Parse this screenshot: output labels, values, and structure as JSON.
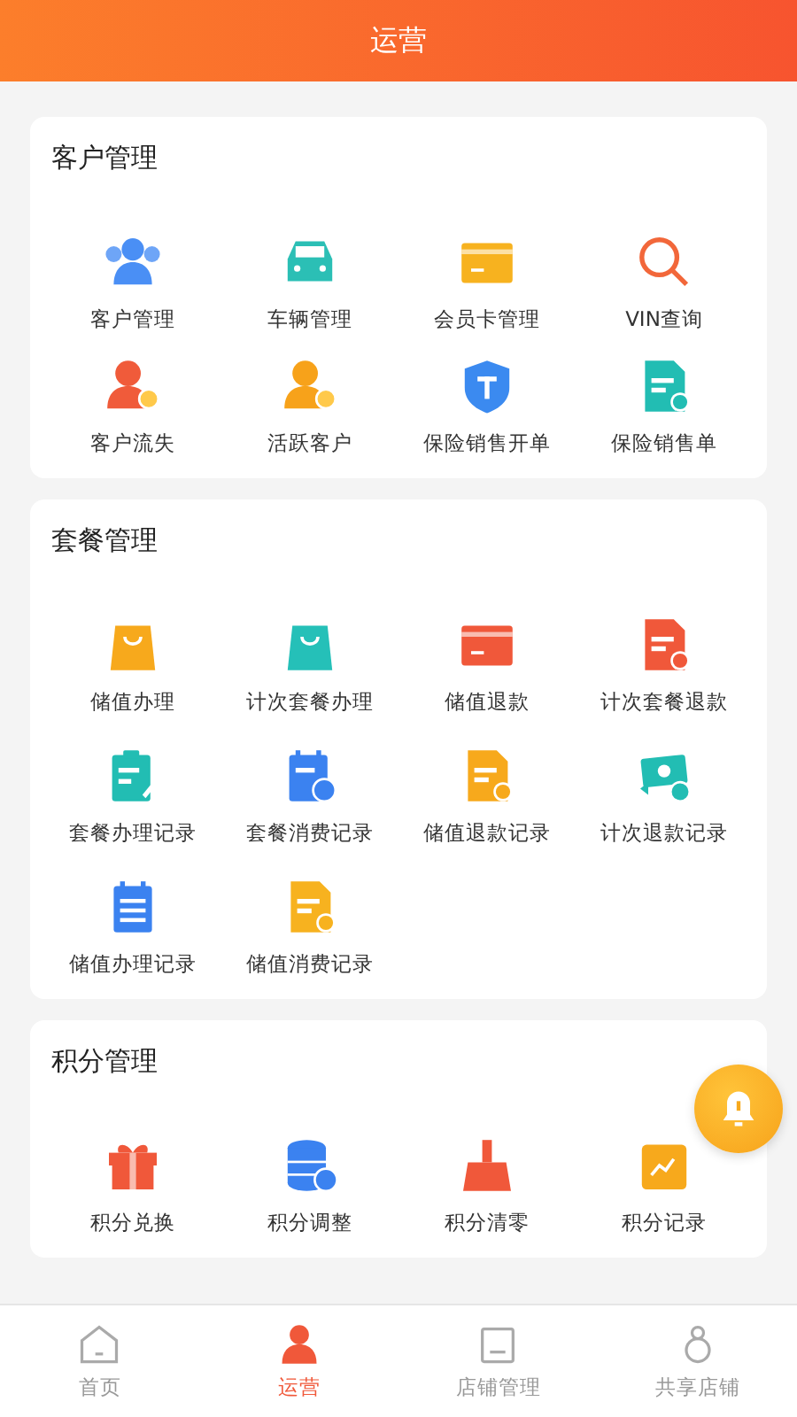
{
  "header": {
    "title": "运营"
  },
  "sections": [
    {
      "title": "客户管理",
      "items": [
        {
          "label": "客户管理"
        },
        {
          "label": "车辆管理"
        },
        {
          "label": "会员卡管理"
        },
        {
          "label": "VIN查询"
        },
        {
          "label": "客户流失"
        },
        {
          "label": "活跃客户"
        },
        {
          "label": "保险销售开单"
        },
        {
          "label": "保险销售单"
        }
      ]
    },
    {
      "title": "套餐管理",
      "items": [
        {
          "label": "储值办理"
        },
        {
          "label": "计次套餐办理"
        },
        {
          "label": "储值退款"
        },
        {
          "label": "计次套餐退款"
        },
        {
          "label": "套餐办理记录"
        },
        {
          "label": "套餐消费记录"
        },
        {
          "label": "储值退款记录"
        },
        {
          "label": "计次退款记录"
        },
        {
          "label": "储值办理记录"
        },
        {
          "label": "储值消费记录"
        }
      ]
    },
    {
      "title": "积分管理",
      "items": [
        {
          "label": "积分兑换"
        },
        {
          "label": "积分调整"
        },
        {
          "label": "积分清零"
        },
        {
          "label": "积分记录"
        }
      ]
    }
  ],
  "tabs": [
    {
      "label": "首页",
      "selected": false
    },
    {
      "label": "运营",
      "selected": true
    },
    {
      "label": "店铺管理",
      "selected": false
    },
    {
      "label": "共享店铺",
      "selected": false
    }
  ]
}
